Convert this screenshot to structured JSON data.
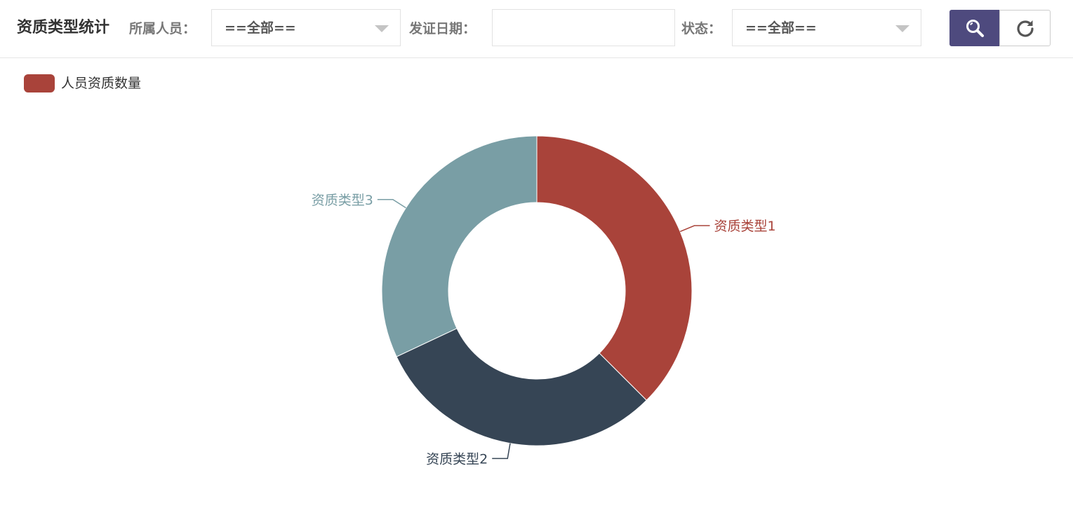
{
  "page": {
    "title": "资质类型统计"
  },
  "filters": {
    "person_label": "所属人员：",
    "person_value": "==全部==",
    "date_label": "发证日期：",
    "date_value": "",
    "status_label": "状态：",
    "status_value": "==全部=="
  },
  "buttons": {
    "search_icon": "search-icon",
    "refresh_icon": "refresh-icon",
    "search_color": "#4e4a7e"
  },
  "chart_data": {
    "type": "pie",
    "legend": [
      "人员资质数量"
    ],
    "legend_position": "top-left",
    "series": [
      {
        "name": "人员资质数量",
        "categories": [
          "资质类型1",
          "资质类型2",
          "资质类型3"
        ],
        "values": [
          37.5,
          30.5,
          32
        ],
        "colors": [
          "#a9433a",
          "#364555",
          "#799ea5"
        ]
      }
    ],
    "donut": true
  }
}
